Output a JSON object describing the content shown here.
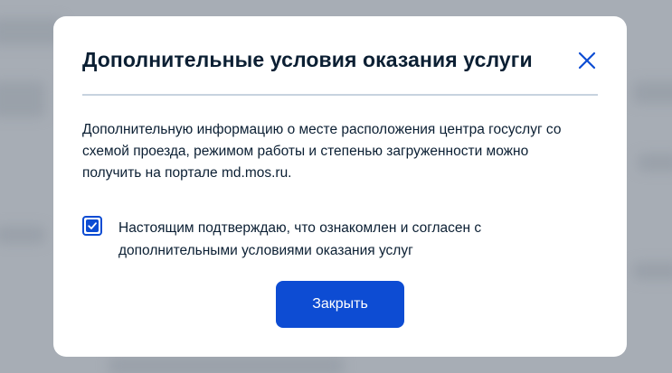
{
  "dialog": {
    "title": "Дополнительные условия оказания услуги",
    "body_text": "Дополнительную информацию о месте расположения центра госуслуг со схемой проезда, режимом работы и степенью загруженности можно получить на портале md.mos.ru.",
    "checkbox": {
      "checked": true,
      "label": "Настоящим подтверждаю, что ознакомлен и согласен с дополнительными условиями оказания услуг"
    },
    "close_button_label": "Закрыть",
    "close_icon": "close-icon"
  },
  "colors": {
    "accent": "#0d4cd3",
    "text": "#0b1f33",
    "divider": "#c7d3df",
    "backdrop": "#a7adb5"
  }
}
